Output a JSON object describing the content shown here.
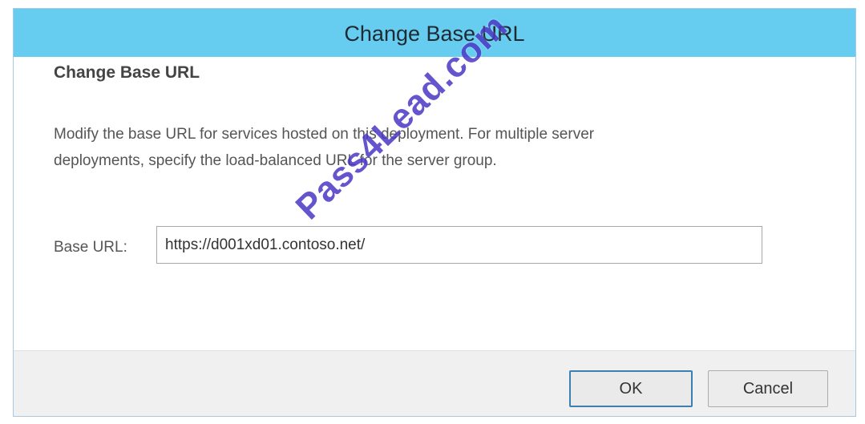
{
  "dialog": {
    "title": "Change Base URL",
    "heading": "Change Base URL",
    "description_line1": "Modify the base URL for services hosted on this deployment. For multiple server",
    "description_line2": "deployments, specify the load-balanced URL for the server group.",
    "base_url_label": "Base URL:",
    "base_url_value": "https://d001xd01.contoso.net/",
    "ok_label": "OK",
    "cancel_label": "Cancel"
  },
  "watermark": {
    "text": "Pass4Lead.com"
  },
  "colors": {
    "title_bar": "#66cdf0",
    "ok_border": "#3c7fb1",
    "footer_bg": "#f0f0f0",
    "watermark": "#4a37c6"
  }
}
